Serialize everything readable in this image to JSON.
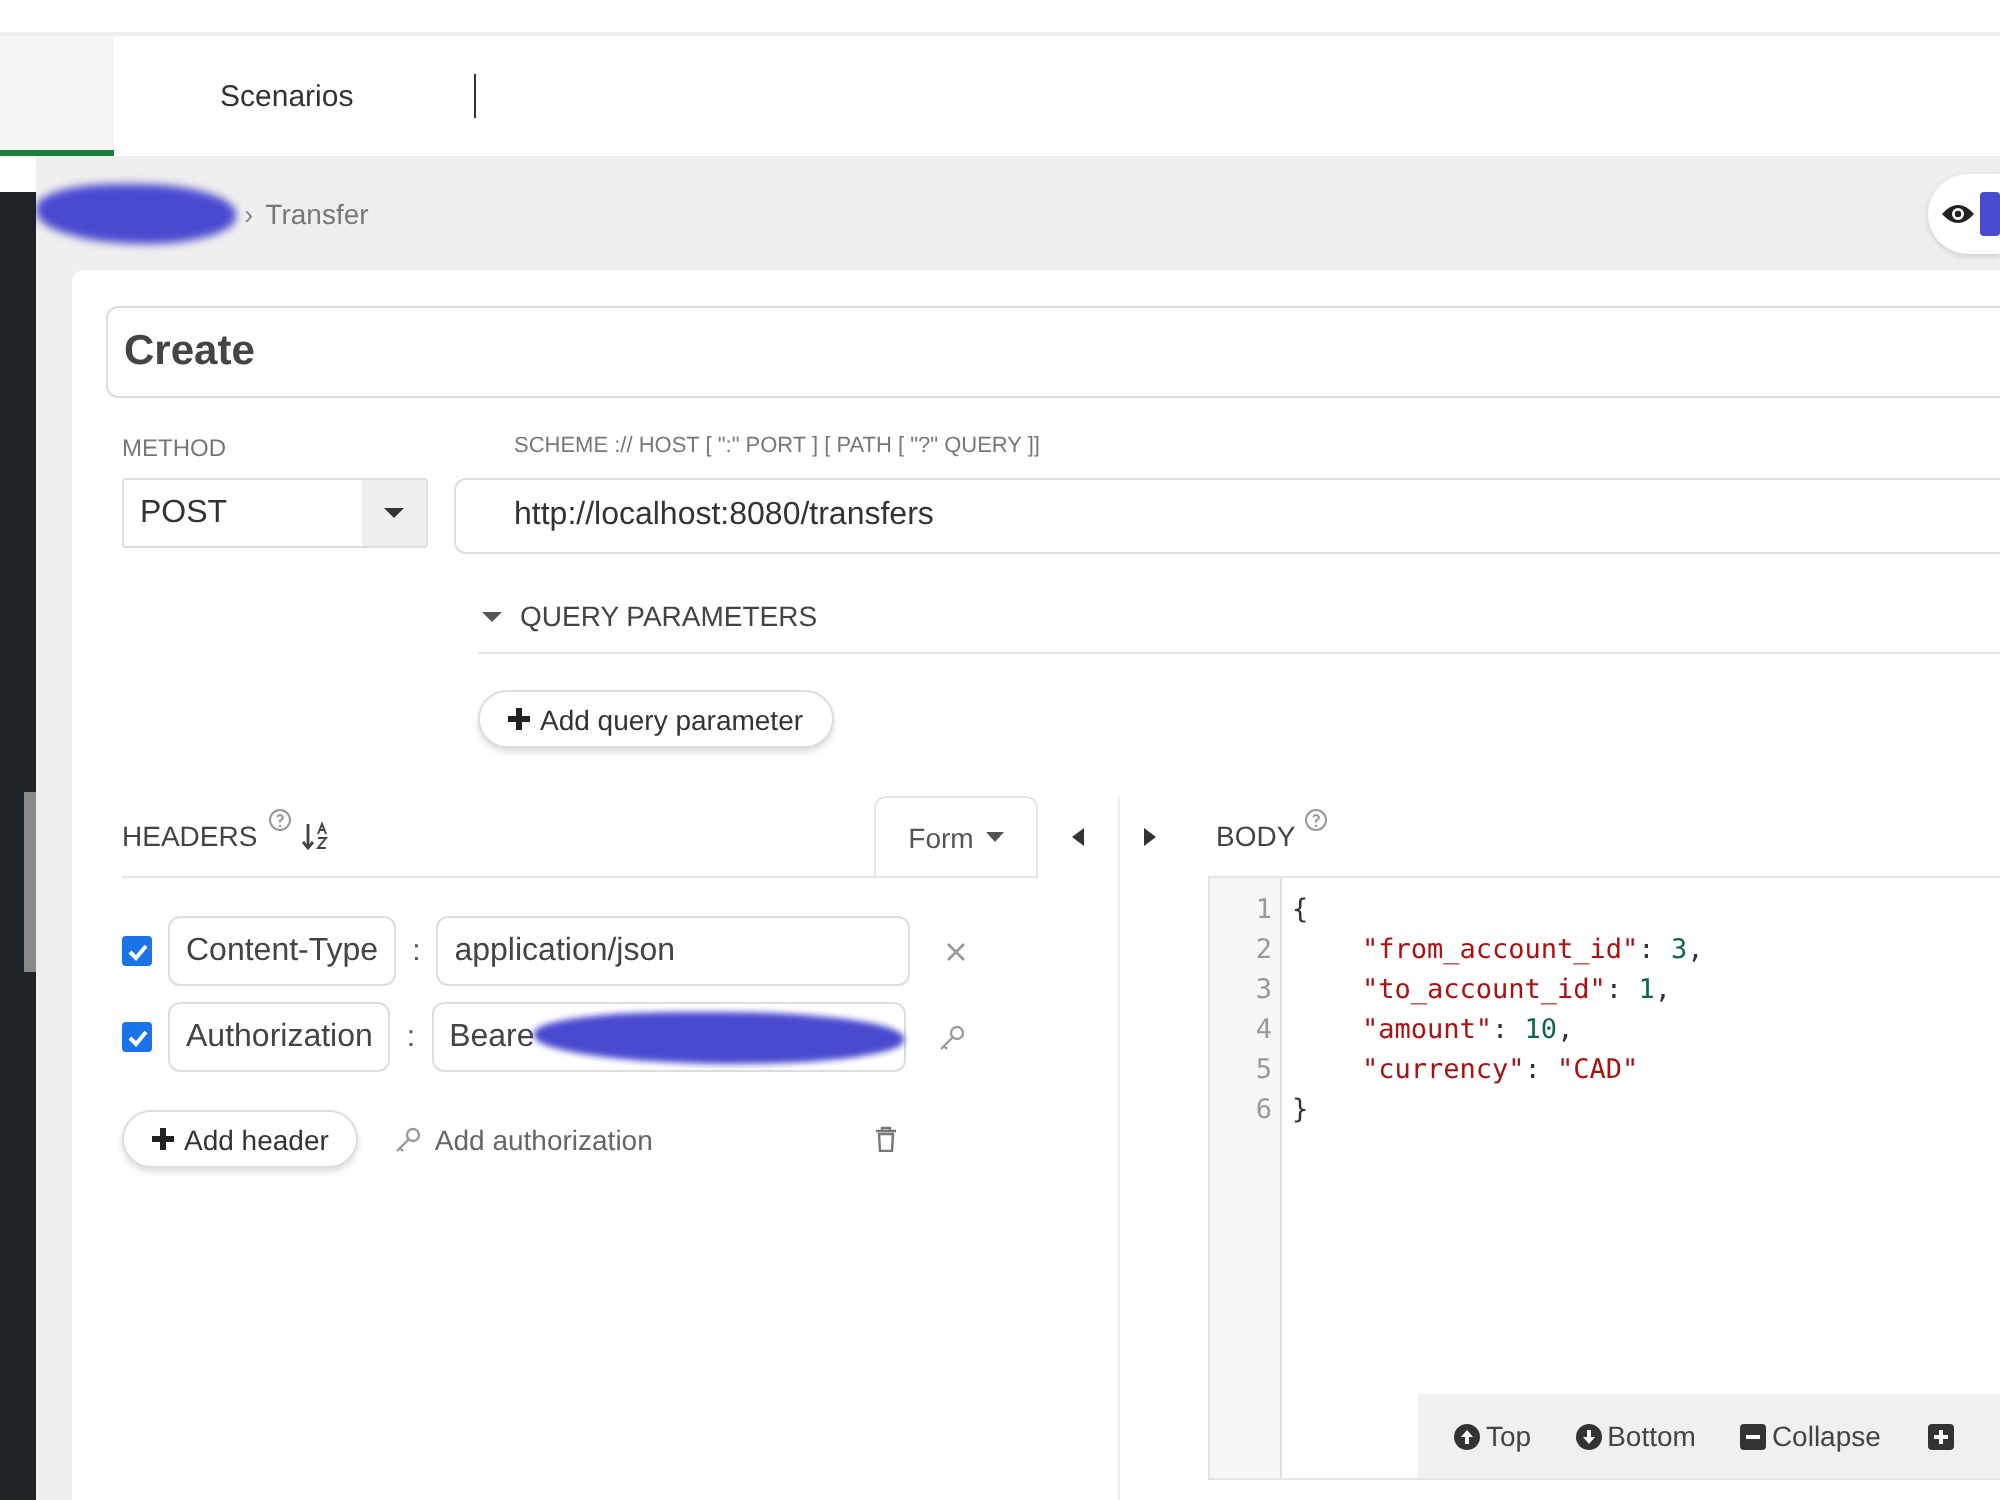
{
  "tabs": [
    {
      "label": "Scenarios",
      "selected": false
    }
  ],
  "breadcrumb": {
    "separator": "›",
    "current": "Transfer"
  },
  "request": {
    "name": "Create",
    "method_label": "METHOD",
    "method": "POST",
    "url_label": "SCHEME :// HOST [ \":\" PORT ] [ PATH [ \"?\" QUERY ]]",
    "url": "http://localhost:8080/transfers",
    "query_section": {
      "title": "QUERY PARAMETERS",
      "expanded": true,
      "add_button": "Add query parameter"
    }
  },
  "headers": {
    "title": "HEADERS",
    "mode": "Form",
    "rows": [
      {
        "kind": "plain",
        "checked": true,
        "name": "Content-Type",
        "separator": ":",
        "value": "application/json"
      },
      {
        "kind": "auth",
        "checked": true,
        "name": "Authorization",
        "separator": ":",
        "value": "Beare"
      }
    ],
    "add_button": "Add header",
    "add_auth": "Add authorization"
  },
  "body": {
    "title": "BODY",
    "lines": [
      {
        "number": "1",
        "indented": false,
        "tokens": [
          {
            "t": "{",
            "kind": "punct"
          }
        ]
      },
      {
        "number": "2",
        "indented": true,
        "tokens": [
          {
            "t": "\"from_account_id\"",
            "kind": "string"
          },
          {
            "t": ": ",
            "kind": "punct"
          },
          {
            "t": "3",
            "kind": "number"
          },
          {
            "t": ",",
            "kind": "punct"
          }
        ]
      },
      {
        "number": "3",
        "indented": true,
        "tokens": [
          {
            "t": "\"to_account_id\"",
            "kind": "string"
          },
          {
            "t": ": ",
            "kind": "punct"
          },
          {
            "t": "1",
            "kind": "number"
          },
          {
            "t": ",",
            "kind": "punct"
          }
        ]
      },
      {
        "number": "4",
        "indented": true,
        "tokens": [
          {
            "t": "\"amount\"",
            "kind": "string"
          },
          {
            "t": ": ",
            "kind": "punct"
          },
          {
            "t": "10",
            "kind": "number"
          },
          {
            "t": ",",
            "kind": "punct"
          }
        ]
      },
      {
        "number": "5",
        "indented": true,
        "tokens": [
          {
            "t": "\"currency\"",
            "kind": "string"
          },
          {
            "t": ": ",
            "kind": "punct"
          },
          {
            "t": "\"CAD\"",
            "kind": "string"
          }
        ]
      },
      {
        "number": "6",
        "indented": false,
        "tokens": [
          {
            "t": "}",
            "kind": "punct"
          }
        ]
      }
    ],
    "toolbar": [
      {
        "label": "Top",
        "kind": "up"
      },
      {
        "label": "Bottom",
        "kind": "down"
      },
      {
        "label": "Collapse",
        "kind": "collapse"
      }
    ]
  }
}
